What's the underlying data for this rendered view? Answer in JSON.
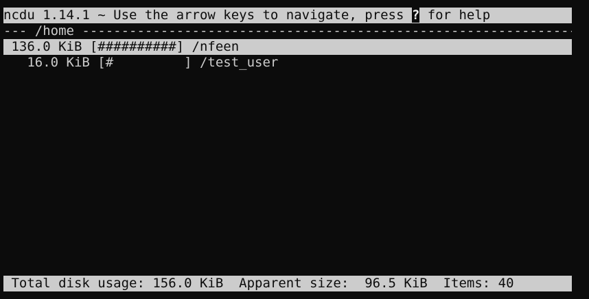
{
  "header": {
    "title_before_key": "ncdu 1.14.1 ~ Use the arrow keys to navigate, press ",
    "help_key": "?",
    "title_after_key": " for help"
  },
  "path_bar": {
    "text": "--- /home -------------------------------------------------------------------"
  },
  "entries": [
    {
      "text": " 136.0 KiB [##########] /nfeen",
      "selected": true
    },
    {
      "text": "   16.0 KiB [#         ] /test_user",
      "selected": false
    }
  ],
  "status_bar": {
    "text": " Total disk usage: 156.0 KiB  Apparent size:  96.5 KiB  Items: 40"
  },
  "colors": {
    "background": "#0c0c0c",
    "foreground": "#cccccc",
    "highlight": "#cccccc"
  }
}
